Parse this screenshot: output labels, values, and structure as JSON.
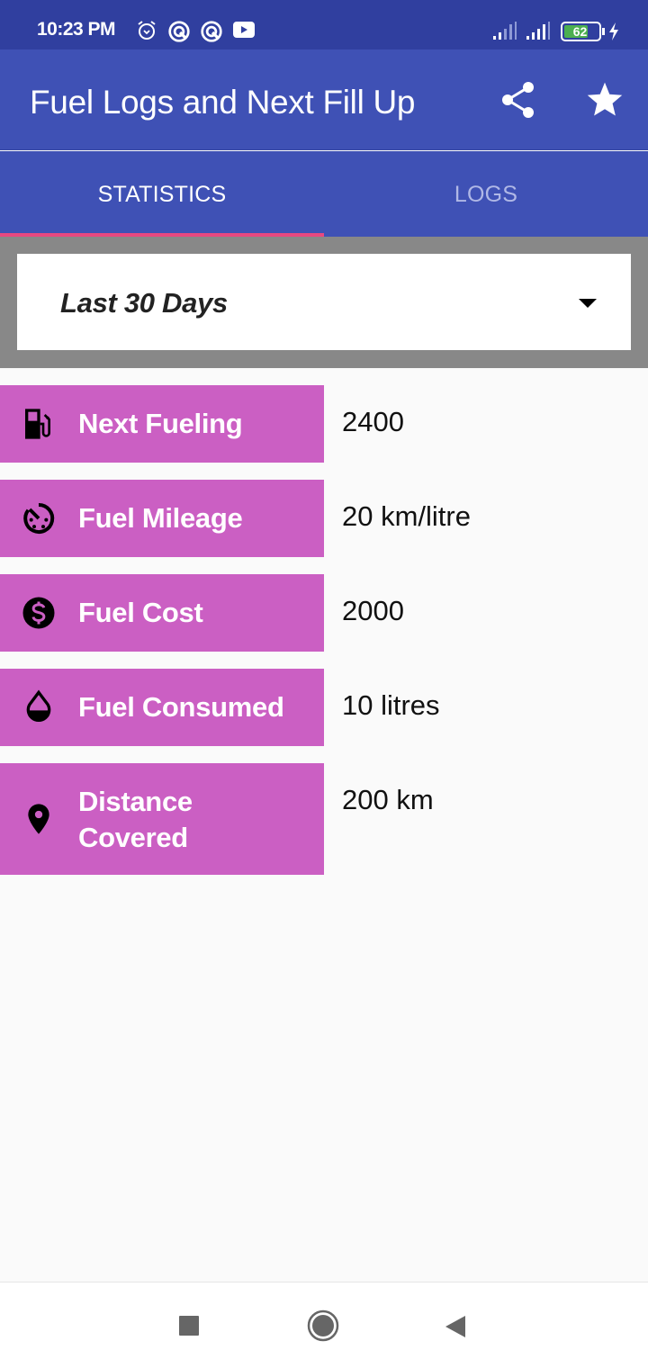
{
  "status_bar": {
    "time": "10:23 PM",
    "battery_level": "62",
    "icons": [
      "alarm-icon",
      "sync-icon",
      "sync-icon",
      "youtube-icon",
      "signal-icon",
      "signal-icon",
      "battery-icon",
      "charging-icon"
    ]
  },
  "app_bar": {
    "title": "Fuel Logs and Next Fill Up",
    "actions": [
      "share-icon",
      "star-icon"
    ]
  },
  "tabs": [
    {
      "label": "STATISTICS",
      "selected": true
    },
    {
      "label": "LOGS",
      "selected": false
    }
  ],
  "filter": {
    "selected": "Last 30 Days"
  },
  "stats": [
    {
      "icon": "fuel-pump-icon",
      "label": "Next Fueling",
      "value": "2400"
    },
    {
      "icon": "speedometer-icon",
      "label": "Fuel Mileage",
      "value": "20 km/litre"
    },
    {
      "icon": "dollar-icon",
      "label": "Fuel Cost",
      "value": "2000"
    },
    {
      "icon": "drop-icon",
      "label": "Fuel Consumed",
      "value": "10 litres"
    },
    {
      "icon": "location-pin-icon",
      "label_line1": "Distance",
      "label_line2": "Covered",
      "value": "200 km"
    }
  ],
  "colors": {
    "primary_dark": "#303f9f",
    "primary": "#3f51b5",
    "accent": "#e84880",
    "stat_label_bg": "#cb5fc3"
  },
  "nav_bar": {
    "buttons": [
      "recents-icon",
      "home-icon",
      "back-icon"
    ]
  }
}
